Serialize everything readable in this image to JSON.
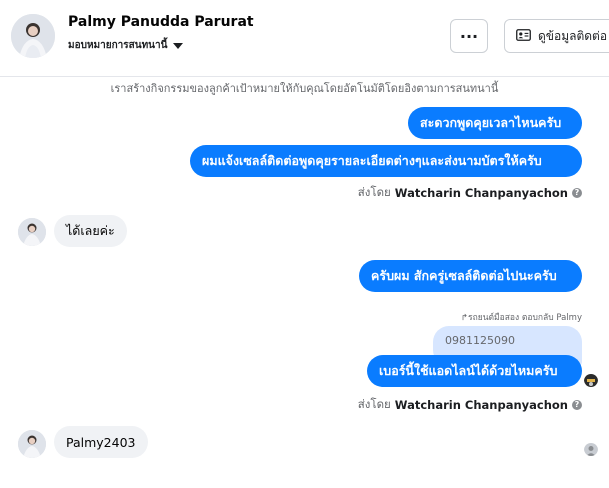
{
  "header": {
    "contact_name": "Palmy Panudda Parurat",
    "assign_label": "มอบหมายการสนทนานี้",
    "more_label": "···",
    "view_contact_label": "ดูข้อมูลติดต่อ"
  },
  "system_notice": "เราสร้างกิจกรรมของลูกค้าเป้าหมายให้กับคุณโดยอัตโนมัติโดยอิงตามการสนทนานี้",
  "messages": {
    "out1": "สะดวกพูดคุยเวลาไหนครับ",
    "out2": "ผมแจ้งเซลล์ติดต่อพูดคุยรายละเอียดต่างๆและส่งนามบัตรให้ครับ",
    "sent_by_1_prefix": "ส่งโดย",
    "sent_by_1_name": "Watcharin Chanpanyachon",
    "in1": "ได้เลยค่ะ",
    "out3": "ครับผม สักครู่เซลล์ติดต่อไปนะครับ",
    "reply_meta": "รถยนต์มือสอง ตอบกลับ Palmy",
    "quoted_text": "0981125090",
    "out4": "เบอร์นี้ใช้แอดไลน์ได้ด้วยไหมครับ",
    "sent_by_2_prefix": "ส่งโดย",
    "sent_by_2_name": "Watcharin Chanpanyachon",
    "in2": "Palmy2403"
  },
  "icons": {
    "more": "ellipsis-icon",
    "contact": "id-card-icon",
    "info": "info-icon",
    "caret": "caret-down-icon",
    "reply": "reply-arrow-icon"
  },
  "colors": {
    "outgoing_bubble": "#0a7cff",
    "incoming_bubble": "#f0f2f5",
    "quoted_bubble": "#d7e6ff"
  }
}
